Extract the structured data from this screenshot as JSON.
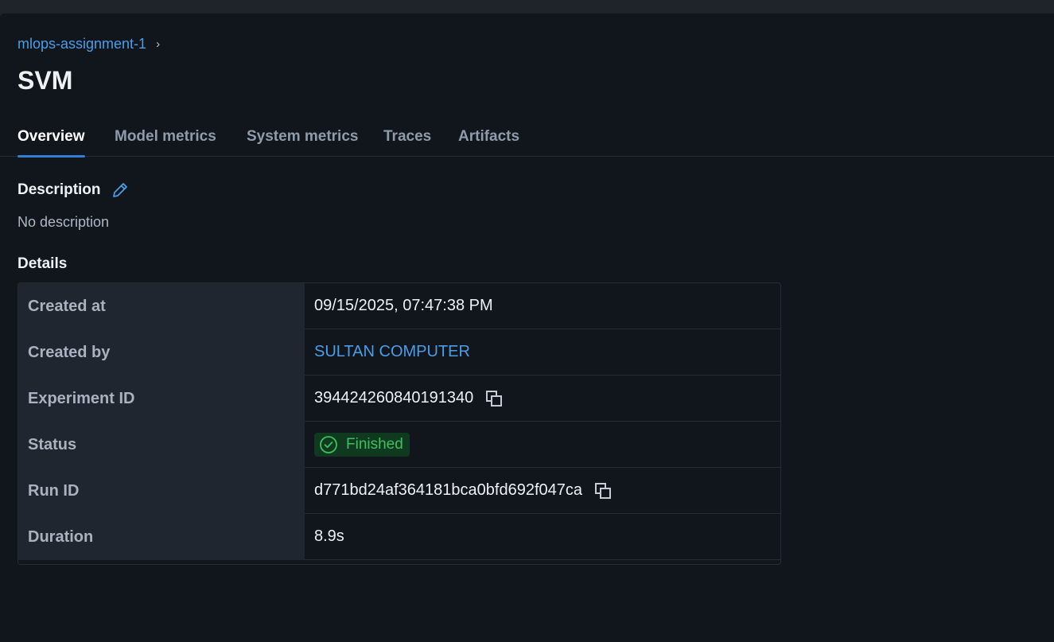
{
  "breadcrumb": {
    "experiment": "mlops-assignment-1",
    "separator": "›"
  },
  "run": {
    "title": "SVM"
  },
  "tabs": [
    {
      "label": "Overview",
      "active": true
    },
    {
      "label": "Model metrics",
      "active": false
    },
    {
      "label": "System metrics",
      "active": false
    },
    {
      "label": "Traces",
      "active": false
    },
    {
      "label": "Artifacts",
      "active": false
    }
  ],
  "description": {
    "heading": "Description",
    "value": "No description",
    "edit_icon": "pencil-icon"
  },
  "details": {
    "heading": "Details",
    "rows": [
      {
        "key": "Created at",
        "value": "09/15/2025, 07:47:38 PM"
      },
      {
        "key": "Created by",
        "value": "SULTAN COMPUTER"
      },
      {
        "key": "Experiment ID",
        "value": "394424260840191340"
      },
      {
        "key": "Status",
        "value": "Finished"
      },
      {
        "key": "Run ID",
        "value": "d771bd24af364181bca0bfd692f047ca"
      },
      {
        "key": "Duration",
        "value": "8.9s"
      }
    ]
  },
  "colors": {
    "link": "#4a9ee8",
    "accent": "#2f7fd3",
    "success": "#3fbf5f",
    "background": "#11161d"
  }
}
